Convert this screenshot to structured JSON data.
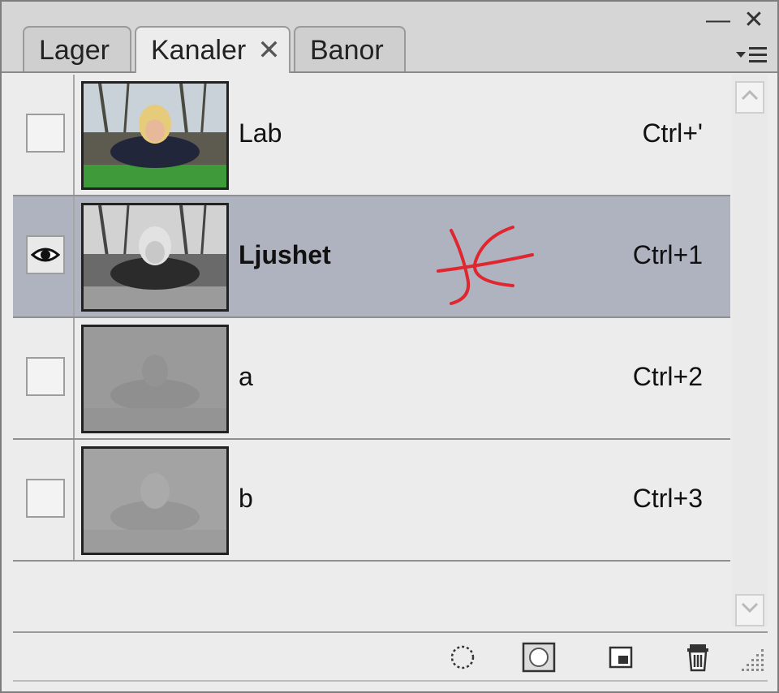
{
  "window": {
    "minimize_label": "—",
    "close_label": "✕"
  },
  "tabs": [
    {
      "label": "Lager",
      "active": false
    },
    {
      "label": "Kanaler",
      "active": true,
      "close": "✕"
    },
    {
      "label": "Banor",
      "active": false
    }
  ],
  "panel_menu_icon": "menu-icon",
  "channels": [
    {
      "name": "Lab",
      "shortcut": "Ctrl+'",
      "visible": false,
      "selected": false
    },
    {
      "name": "Ljushet",
      "shortcut": "Ctrl+1",
      "visible": true,
      "selected": true
    },
    {
      "name": "a",
      "shortcut": "Ctrl+2",
      "visible": false,
      "selected": false
    },
    {
      "name": "b",
      "shortcut": "Ctrl+3",
      "visible": false,
      "selected": false
    }
  ],
  "footer_buttons": [
    {
      "icon": "load-selection-icon"
    },
    {
      "icon": "save-selection-icon"
    },
    {
      "icon": "new-channel-icon"
    },
    {
      "icon": "trash-icon"
    }
  ],
  "colors": {
    "selected_row": "#afb3c0",
    "annotation": "#e0262e"
  }
}
